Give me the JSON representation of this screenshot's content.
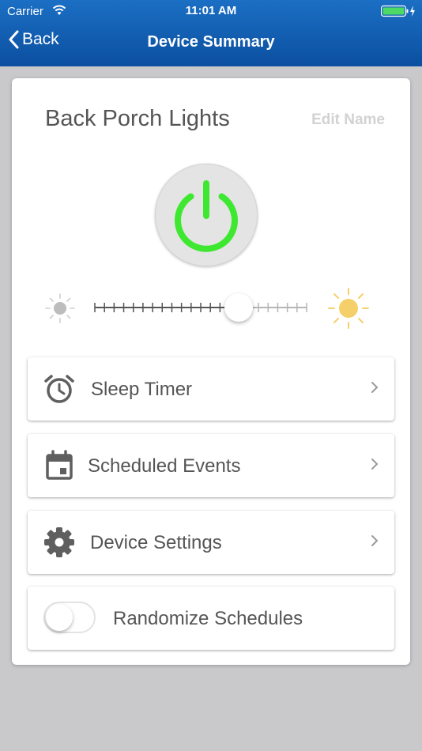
{
  "status_bar": {
    "carrier": "Carrier",
    "time": "11:01 AM",
    "wifi_icon": "wifi-icon",
    "battery_icon": "battery-charging-icon"
  },
  "nav": {
    "back_label": "Back",
    "title": "Device Summary"
  },
  "device": {
    "name": "Back Porch Lights",
    "edit_label": "Edit Name",
    "power_on": true,
    "power_color": "#3ee830",
    "brightness": 0.68
  },
  "menu": {
    "sleep_timer": "Sleep Timer",
    "scheduled_events": "Scheduled Events",
    "device_settings": "Device Settings",
    "randomize_schedules": "Randomize Schedules",
    "randomize_on": false
  },
  "colors": {
    "nav_bar": "#0b4fa0",
    "sun_bright": "#f5d06a",
    "text": "#555555"
  }
}
